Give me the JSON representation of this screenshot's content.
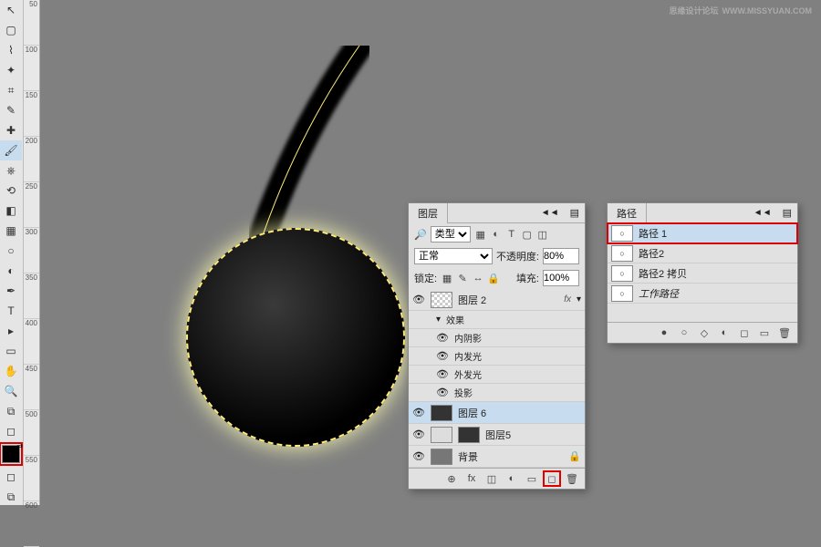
{
  "watermark": {
    "text": "思缘设计论坛",
    "url": "WWW.MISSYUAN.COM"
  },
  "ruler": {
    "marks": [
      "50",
      "100",
      "150",
      "200",
      "250",
      "300",
      "350",
      "400",
      "450",
      "500",
      "550",
      "600"
    ]
  },
  "tools": [
    {
      "name": "move",
      "glyph": "↖"
    },
    {
      "name": "marquee",
      "glyph": "▢"
    },
    {
      "name": "lasso",
      "glyph": "⌇"
    },
    {
      "name": "wand",
      "glyph": "✦"
    },
    {
      "name": "crop",
      "glyph": "⌗"
    },
    {
      "name": "eyedropper",
      "glyph": "✎"
    },
    {
      "name": "heal",
      "glyph": "✚"
    },
    {
      "name": "brush",
      "glyph": "🖌"
    },
    {
      "name": "stamp",
      "glyph": "⎈"
    },
    {
      "name": "history",
      "glyph": "⟲"
    },
    {
      "name": "eraser",
      "glyph": "◧"
    },
    {
      "name": "gradient",
      "glyph": "▦"
    },
    {
      "name": "blur",
      "glyph": "○"
    },
    {
      "name": "dodge",
      "glyph": "◐"
    },
    {
      "name": "pen",
      "glyph": "✒"
    },
    {
      "name": "type",
      "glyph": "T"
    },
    {
      "name": "path-sel",
      "glyph": "▸"
    },
    {
      "name": "shape",
      "glyph": "▭"
    },
    {
      "name": "hand",
      "glyph": "✋"
    },
    {
      "name": "zoom",
      "glyph": "🔍"
    },
    {
      "name": "quick",
      "glyph": "⧉"
    },
    {
      "name": "mask",
      "glyph": "◻"
    }
  ],
  "layers_panel": {
    "title": "图层",
    "filter_label": "类型",
    "filter_icons": [
      "▦",
      "◐",
      "T",
      "▢",
      "◫"
    ],
    "blend": "正常",
    "opacity_label": "不透明度:",
    "opacity": "80%",
    "lock_label": "锁定:",
    "fill_label": "填充:",
    "fill": "100%",
    "lock_icons": [
      "▦",
      "✎",
      "↔",
      "🔒"
    ],
    "effects_label": "效果",
    "fx": [
      "内阴影",
      "内发光",
      "外发光",
      "投影"
    ],
    "layers": [
      {
        "name": "图层 2",
        "thumb": "checker",
        "fx": true,
        "sel": false
      },
      {
        "name": "图层 6",
        "thumb": "black",
        "fx": false,
        "sel": true
      },
      {
        "name": "图层5",
        "thumb": "mask",
        "fx": false,
        "sel": false
      },
      {
        "name": "背景",
        "thumb": "gray",
        "fx": false,
        "sel": false,
        "lock": true
      }
    ],
    "foot_icons": [
      "⊕",
      "fx",
      "◫",
      "◐",
      "▭",
      "◻",
      "🗑"
    ]
  },
  "paths_panel": {
    "title": "路径",
    "items": [
      {
        "name": "路径 1",
        "sel": true,
        "highlight": true
      },
      {
        "name": "路径2",
        "sel": false
      },
      {
        "name": "路径2 拷贝",
        "sel": false
      },
      {
        "name": "工作路径",
        "sel": false,
        "italic": true
      }
    ],
    "foot_icons": [
      "●",
      "○",
      "◇",
      "◐",
      "◻",
      "▭",
      "🗑"
    ]
  }
}
